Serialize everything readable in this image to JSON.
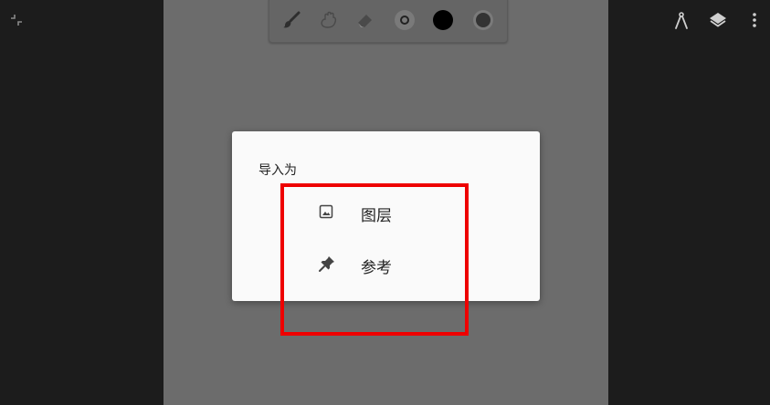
{
  "app": {
    "left_sidebar": {
      "icon": "fullscreen-exit-icon"
    },
    "right_toolbar": {
      "icons": [
        "ruler-icon",
        "layers-icon",
        "more-vert-icon"
      ]
    }
  },
  "toolbar": {
    "tools": [
      "brush-icon",
      "smudge-icon",
      "eraser-icon",
      "brush-size-icon",
      "color-swatch",
      "opacity-icon"
    ],
    "color": "#000000"
  },
  "dialog": {
    "title": "导入为",
    "options": [
      {
        "label": "图层",
        "icon": "image-icon"
      },
      {
        "label": "参考",
        "icon": "pin-icon"
      }
    ]
  },
  "annotation": {
    "color": "#ee0000"
  }
}
